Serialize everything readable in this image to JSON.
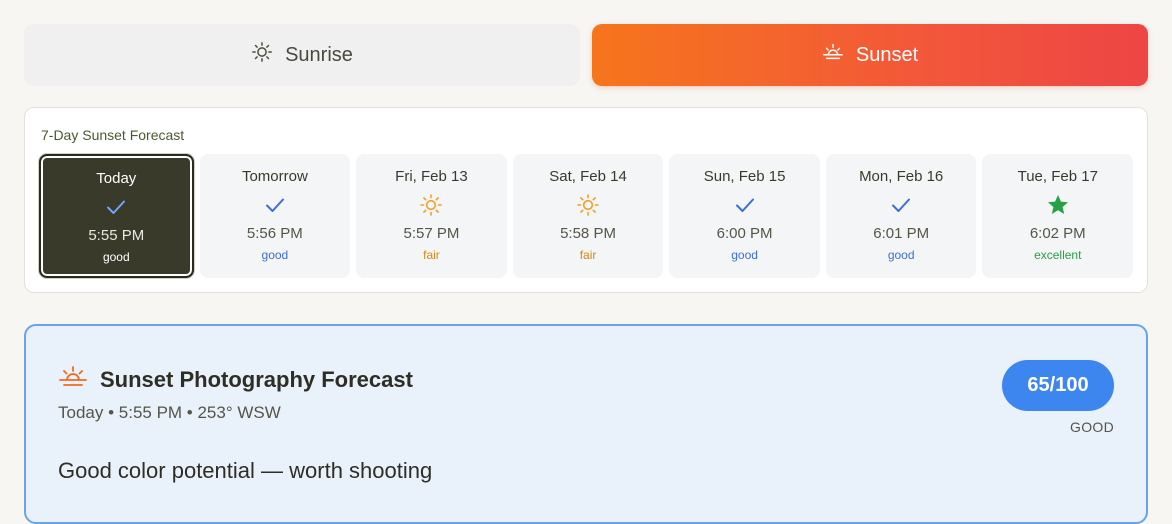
{
  "toggle": {
    "sunrise_label": "Sunrise",
    "sunset_label": "Sunset",
    "active": "sunset"
  },
  "forecast": {
    "heading": "7-Day Sunset Forecast",
    "days": [
      {
        "label": "Today",
        "icon": "check-icon",
        "time": "5:55 PM",
        "quality": "good",
        "selected": true
      },
      {
        "label": "Tomorrow",
        "icon": "check-icon",
        "time": "5:56 PM",
        "quality": "good",
        "selected": false
      },
      {
        "label": "Fri, Feb 13",
        "icon": "sun-icon",
        "time": "5:57 PM",
        "quality": "fair",
        "selected": false
      },
      {
        "label": "Sat, Feb 14",
        "icon": "sun-icon",
        "time": "5:58 PM",
        "quality": "fair",
        "selected": false
      },
      {
        "label": "Sun, Feb 15",
        "icon": "check-icon",
        "time": "6:00 PM",
        "quality": "good",
        "selected": false
      },
      {
        "label": "Mon, Feb 16",
        "icon": "check-icon",
        "time": "6:01 PM",
        "quality": "good",
        "selected": false
      },
      {
        "label": "Tue, Feb 17",
        "icon": "star-icon",
        "time": "6:02 PM",
        "quality": "excellent",
        "selected": false
      }
    ]
  },
  "detail": {
    "title": "Sunset Photography Forecast",
    "subtitle": "Today • 5:55 PM • 253° WSW",
    "score": "65/100",
    "score_label": "GOOD",
    "headline": "Good color potential — worth shooting"
  },
  "colors": {
    "accent_orange": "#f6751c",
    "accent_red": "#ee4545",
    "good": "#3a6fd8",
    "fair": "#d9860c",
    "excellent": "#27a046",
    "score_blue": "#3d86f0"
  }
}
